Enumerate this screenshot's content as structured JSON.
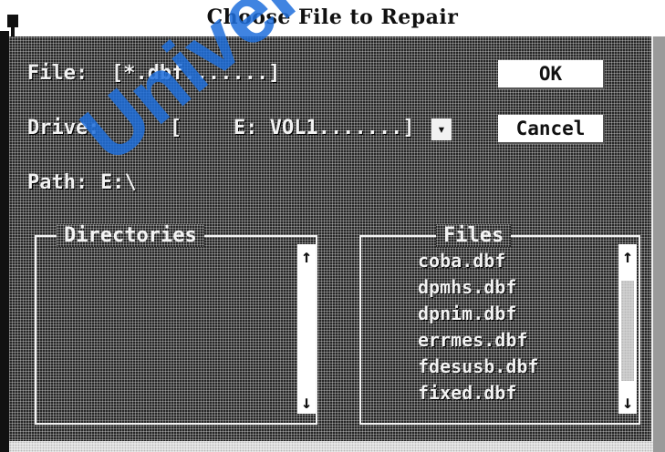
{
  "window": {
    "title": "Choose File to Repair",
    "system_menu_icon": "system-menu-icon"
  },
  "form": {
    "file_label": "File:",
    "file_value": "[*.dbf.......]",
    "drive_label": "Drive:",
    "drive_open_bracket": "[",
    "drive_value": "E: VOL1.......]",
    "drive_dropdown_icon": "▾",
    "path_label": "Path:",
    "path_value": "E:\\"
  },
  "buttons": {
    "ok_label": "OK",
    "cancel_label": "Cancel"
  },
  "directories": {
    "title": "Directories",
    "items": [],
    "scroll_up": "↑",
    "scroll_down": "↓"
  },
  "files": {
    "title": "Files",
    "items": [
      "coba.dbf",
      "dpmhs.dbf",
      "dpnim.dbf",
      "errmes.dbf",
      "fdesusb.dbf",
      "fixed.dbf"
    ],
    "scroll_up": "↑",
    "scroll_down": "↓"
  },
  "watermark": "Univers",
  "colors": {
    "dialog_background": "#3a3a3a",
    "text": "#f2f2f2",
    "button_background": "#ffffff",
    "watermark": "#1e6edc"
  }
}
